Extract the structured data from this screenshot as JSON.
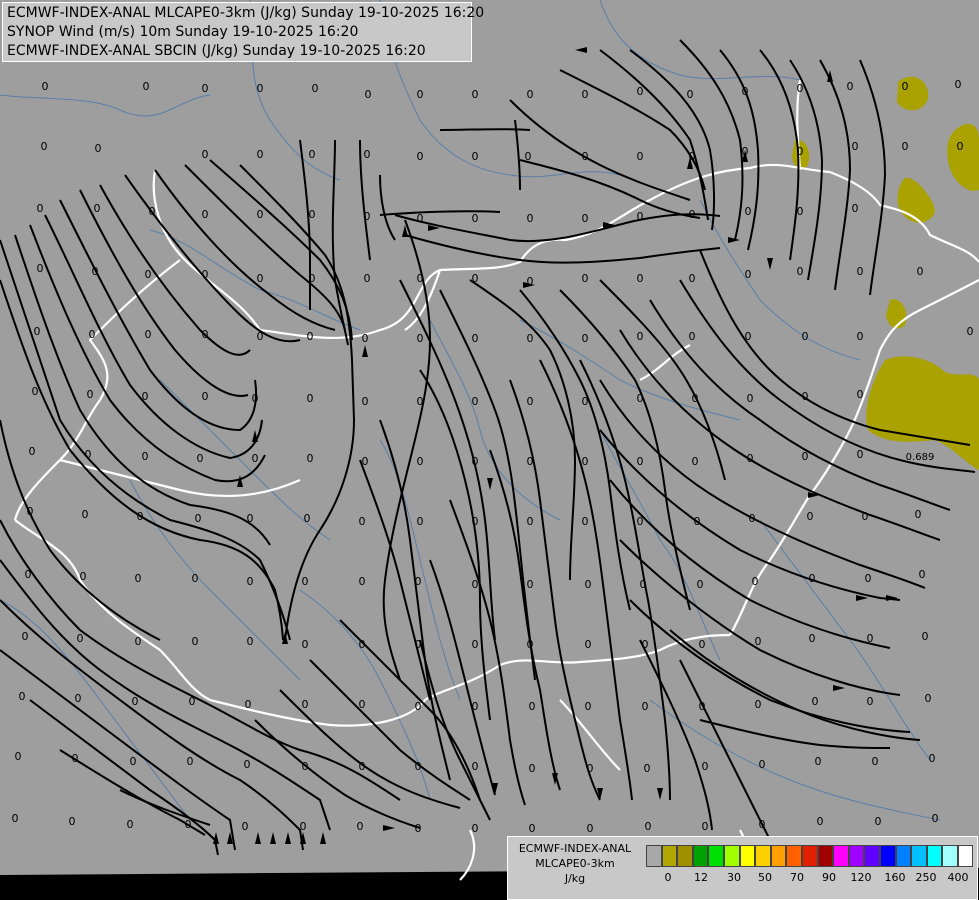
{
  "header": {
    "line1": "ECMWF-INDEX-ANAL MLCAPE0-3km (J/kg) Sunday 19-10-2025 16:20",
    "line2": "SYNOP Wind (m/s) 10m Sunday 19-10-2025 16:20",
    "line3": "ECMWF-INDEX-ANAL SBCIN (J/kg) Sunday 19-10-2025 16:20"
  },
  "legend": {
    "line1": "ECMWF-INDEX-ANAL",
    "line2": "MLCAPE0-3km",
    "line3": "J/kg",
    "ticks": [
      "0",
      "12",
      "30",
      "50",
      "70",
      "90",
      "120",
      "160",
      "250",
      "400"
    ],
    "colors": [
      "#a8a8a8",
      "#b0a800",
      "#a09000",
      "#00a000",
      "#00e000",
      "#a0ff00",
      "#ffff00",
      "#ffd000",
      "#ffa000",
      "#ff6000",
      "#e02000",
      "#a00000",
      "#ff00ff",
      "#a000ff",
      "#6000ff",
      "#0000ff",
      "#0080ff",
      "#00c0ff",
      "#00ffff",
      "#a0ffff",
      "#ffffff"
    ]
  },
  "map": {
    "colors": {
      "background": "#9e9e9e",
      "borders": "#ffffff",
      "rivers": "#5a7fa8",
      "streamlines": "#000000",
      "cape": "#aaa200"
    },
    "annotation": "0.689",
    "cin_labels": [
      [
        45,
        90
      ],
      [
        98,
        152
      ],
      [
        44,
        150
      ],
      [
        146,
        90
      ],
      [
        205,
        92
      ],
      [
        260,
        92
      ],
      [
        315,
        92
      ],
      [
        368,
        98
      ],
      [
        420,
        98
      ],
      [
        475,
        98
      ],
      [
        530,
        98
      ],
      [
        585,
        98
      ],
      [
        640,
        95
      ],
      [
        690,
        98
      ],
      [
        745,
        95
      ],
      [
        800,
        92
      ],
      [
        850,
        90
      ],
      [
        905,
        90
      ],
      [
        958,
        88
      ],
      [
        205,
        158
      ],
      [
        260,
        158
      ],
      [
        312,
        158
      ],
      [
        367,
        158
      ],
      [
        420,
        160
      ],
      [
        475,
        160
      ],
      [
        528,
        160
      ],
      [
        585,
        160
      ],
      [
        640,
        160
      ],
      [
        692,
        160
      ],
      [
        745,
        155
      ],
      [
        800,
        155
      ],
      [
        855,
        150
      ],
      [
        905,
        150
      ],
      [
        960,
        150
      ],
      [
        40,
        212
      ],
      [
        97,
        212
      ],
      [
        152,
        215
      ],
      [
        205,
        218
      ],
      [
        260,
        218
      ],
      [
        312,
        218
      ],
      [
        367,
        220
      ],
      [
        420,
        222
      ],
      [
        475,
        222
      ],
      [
        530,
        222
      ],
      [
        585,
        222
      ],
      [
        640,
        220
      ],
      [
        692,
        218
      ],
      [
        748,
        215
      ],
      [
        800,
        215
      ],
      [
        855,
        212
      ],
      [
        40,
        272
      ],
      [
        95,
        275
      ],
      [
        148,
        278
      ],
      [
        205,
        278
      ],
      [
        260,
        282
      ],
      [
        312,
        282
      ],
      [
        367,
        282
      ],
      [
        420,
        282
      ],
      [
        475,
        282
      ],
      [
        530,
        285
      ],
      [
        585,
        282
      ],
      [
        640,
        282
      ],
      [
        692,
        282
      ],
      [
        748,
        278
      ],
      [
        800,
        275
      ],
      [
        860,
        275
      ],
      [
        920,
        275
      ],
      [
        37,
        335
      ],
      [
        92,
        338
      ],
      [
        148,
        338
      ],
      [
        205,
        338
      ],
      [
        260,
        340
      ],
      [
        310,
        340
      ],
      [
        365,
        342
      ],
      [
        420,
        342
      ],
      [
        475,
        342
      ],
      [
        530,
        342
      ],
      [
        585,
        342
      ],
      [
        640,
        340
      ],
      [
        692,
        340
      ],
      [
        748,
        340
      ],
      [
        805,
        340
      ],
      [
        860,
        340
      ],
      [
        970,
        335
      ],
      [
        35,
        395
      ],
      [
        90,
        398
      ],
      [
        145,
        400
      ],
      [
        205,
        400
      ],
      [
        255,
        402
      ],
      [
        310,
        402
      ],
      [
        365,
        405
      ],
      [
        420,
        405
      ],
      [
        475,
        405
      ],
      [
        530,
        405
      ],
      [
        585,
        405
      ],
      [
        640,
        402
      ],
      [
        695,
        402
      ],
      [
        750,
        402
      ],
      [
        805,
        400
      ],
      [
        860,
        398
      ],
      [
        32,
        455
      ],
      [
        88,
        458
      ],
      [
        145,
        460
      ],
      [
        200,
        462
      ],
      [
        255,
        462
      ],
      [
        310,
        462
      ],
      [
        365,
        465
      ],
      [
        420,
        465
      ],
      [
        475,
        465
      ],
      [
        530,
        465
      ],
      [
        585,
        465
      ],
      [
        640,
        465
      ],
      [
        695,
        465
      ],
      [
        750,
        462
      ],
      [
        805,
        460
      ],
      [
        860,
        458
      ],
      [
        30,
        515
      ],
      [
        85,
        518
      ],
      [
        140,
        520
      ],
      [
        198,
        522
      ],
      [
        250,
        522
      ],
      [
        307,
        522
      ],
      [
        362,
        525
      ],
      [
        420,
        525
      ],
      [
        475,
        525
      ],
      [
        530,
        525
      ],
      [
        585,
        525
      ],
      [
        640,
        525
      ],
      [
        697,
        525
      ],
      [
        752,
        522
      ],
      [
        810,
        520
      ],
      [
        865,
        520
      ],
      [
        918,
        518
      ],
      [
        28,
        578
      ],
      [
        83,
        580
      ],
      [
        138,
        582
      ],
      [
        195,
        582
      ],
      [
        250,
        585
      ],
      [
        305,
        585
      ],
      [
        362,
        585
      ],
      [
        418,
        585
      ],
      [
        475,
        588
      ],
      [
        530,
        588
      ],
      [
        588,
        588
      ],
      [
        643,
        588
      ],
      [
        700,
        588
      ],
      [
        755,
        585
      ],
      [
        812,
        582
      ],
      [
        868,
        582
      ],
      [
        922,
        578
      ],
      [
        25,
        640
      ],
      [
        80,
        642
      ],
      [
        138,
        645
      ],
      [
        195,
        645
      ],
      [
        250,
        645
      ],
      [
        305,
        648
      ],
      [
        362,
        648
      ],
      [
        418,
        648
      ],
      [
        475,
        648
      ],
      [
        530,
        648
      ],
      [
        588,
        648
      ],
      [
        645,
        648
      ],
      [
        702,
        648
      ],
      [
        758,
        645
      ],
      [
        812,
        642
      ],
      [
        870,
        642
      ],
      [
        925,
        640
      ],
      [
        22,
        700
      ],
      [
        78,
        702
      ],
      [
        135,
        705
      ],
      [
        192,
        705
      ],
      [
        248,
        708
      ],
      [
        305,
        708
      ],
      [
        362,
        708
      ],
      [
        418,
        710
      ],
      [
        475,
        710
      ],
      [
        532,
        710
      ],
      [
        588,
        710
      ],
      [
        645,
        710
      ],
      [
        702,
        710
      ],
      [
        758,
        708
      ],
      [
        815,
        705
      ],
      [
        870,
        705
      ],
      [
        928,
        702
      ],
      [
        18,
        760
      ],
      [
        75,
        762
      ],
      [
        133,
        765
      ],
      [
        190,
        765
      ],
      [
        247,
        768
      ],
      [
        305,
        770
      ],
      [
        362,
        770
      ],
      [
        418,
        770
      ],
      [
        475,
        770
      ],
      [
        532,
        772
      ],
      [
        590,
        772
      ],
      [
        647,
        772
      ],
      [
        705,
        770
      ],
      [
        762,
        768
      ],
      [
        818,
        765
      ],
      [
        875,
        765
      ],
      [
        932,
        762
      ],
      [
        15,
        822
      ],
      [
        72,
        825
      ],
      [
        130,
        828
      ],
      [
        188,
        828
      ],
      [
        245,
        830
      ],
      [
        303,
        830
      ],
      [
        360,
        830
      ],
      [
        418,
        832
      ],
      [
        475,
        832
      ],
      [
        532,
        832
      ],
      [
        590,
        832
      ],
      [
        648,
        830
      ],
      [
        705,
        830
      ],
      [
        762,
        828
      ],
      [
        820,
        825
      ],
      [
        878,
        825
      ],
      [
        935,
        822
      ]
    ]
  }
}
